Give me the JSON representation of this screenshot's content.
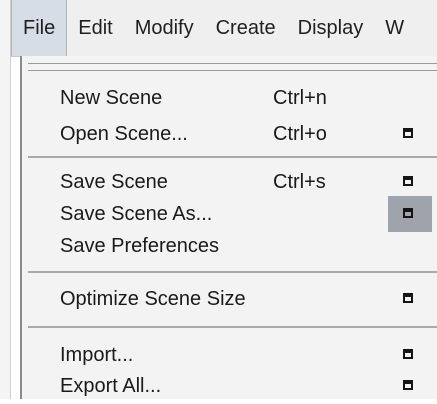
{
  "menubar": {
    "items": [
      "File",
      "Edit",
      "Modify",
      "Create",
      "Display",
      "W"
    ]
  },
  "file_menu": {
    "groups": [
      [
        {
          "label": "New Scene",
          "shortcut": "Ctrl+n",
          "options_icon": false
        },
        {
          "label": "Open Scene...",
          "shortcut": "Ctrl+o",
          "options_icon": true
        }
      ],
      [
        {
          "label": "Save Scene",
          "shortcut": "Ctrl+s",
          "options_icon": true
        },
        {
          "label": "Save Scene As...",
          "shortcut": "",
          "options_icon": true,
          "hovered_box": true
        },
        {
          "label": "Save Preferences",
          "shortcut": "",
          "options_icon": false
        }
      ],
      [
        {
          "label": "Optimize Scene Size",
          "shortcut": "",
          "options_icon": true
        }
      ],
      [
        {
          "label": "Import...",
          "shortcut": "",
          "options_icon": true
        },
        {
          "label": "Export All...",
          "shortcut": "",
          "options_icon": true
        }
      ]
    ]
  },
  "colors": {
    "menubar_bg": "#efefef",
    "menu_bg": "#f3f3f3",
    "hover_box": "#9fa3ab"
  },
  "icons": {
    "options_box": "option-box-icon"
  }
}
